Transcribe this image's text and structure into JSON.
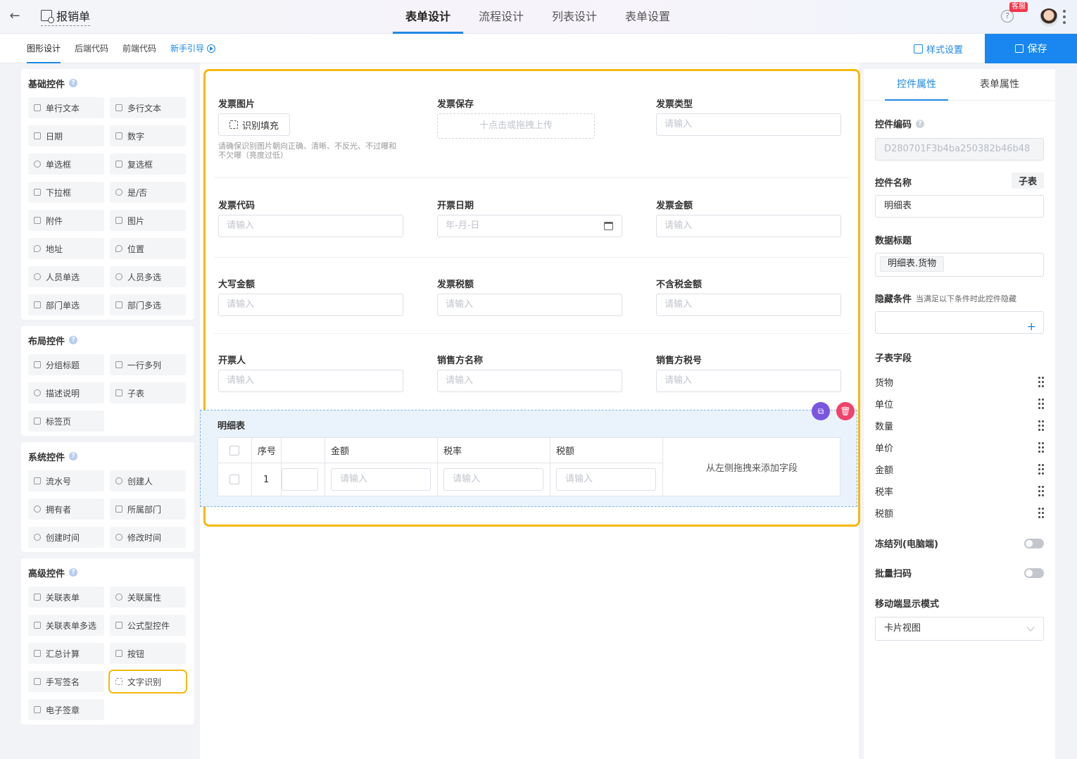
{
  "topbar": {
    "title": "报销单",
    "tabs": [
      "表单设计",
      "流程设计",
      "列表设计",
      "表单设置"
    ],
    "active_tab": "表单设计",
    "kefu_badge": "客服",
    "help": "?"
  },
  "subbar": {
    "tabs": [
      "图形设计",
      "后端代码",
      "前端代码"
    ],
    "guide": "新手引导",
    "style_button": "样式设置",
    "save_button": "保存"
  },
  "left": {
    "groups": [
      {
        "title": "基础控件",
        "items": [
          "单行文本",
          "多行文本",
          "日期",
          "数字",
          "单选框",
          "复选框",
          "下拉框",
          "是/否",
          "附件",
          "图片",
          "地址",
          "位置",
          "人员单选",
          "人员多选",
          "部门单选",
          "部门多选"
        ]
      },
      {
        "title": "布局控件",
        "items": [
          "分组标题",
          "一行多列",
          "描述说明",
          "子表",
          "标签页"
        ]
      },
      {
        "title": "系统控件",
        "items": [
          "流水号",
          "创建人",
          "拥有者",
          "所属部门",
          "创建时间",
          "修改时间"
        ]
      },
      {
        "title": "高级控件",
        "items": [
          "关联表单",
          "关联属性",
          "关联表单多选",
          "公式型控件",
          "汇总计算",
          "按钮",
          "手写签名",
          "文字识别",
          "电子签章"
        ]
      }
    ],
    "highlighted_item": "文字识别"
  },
  "form": {
    "invoice_image": {
      "label": "发票图片",
      "button": "识别填充",
      "hint": "请确保识别图片朝向正确、清晰、不反光、不过曝和不欠曝（亮度过低）"
    },
    "invoice_save": {
      "label": "发票保存",
      "upload": "十点击或拖拽上传"
    },
    "invoice_type": {
      "label": "发票类型",
      "placeholder": "请输入"
    },
    "invoice_code": {
      "label": "发票代码",
      "placeholder": "请输入"
    },
    "issue_date": {
      "label": "开票日期",
      "placeholder": "年-月-日"
    },
    "invoice_amount": {
      "label": "发票金额",
      "placeholder": "请输入"
    },
    "amount_upper": {
      "label": "大写金额",
      "placeholder": "请输入"
    },
    "invoice_tax": {
      "label": "发票税额",
      "placeholder": "请输入"
    },
    "amount_ex_tax": {
      "label": "不含税金额",
      "placeholder": "请输入"
    },
    "drawer": {
      "label": "开票人",
      "placeholder": "请输入"
    },
    "seller_name": {
      "label": "销售方名称",
      "placeholder": "请输入"
    },
    "seller_tax_no": {
      "label": "销售方税号",
      "placeholder": "请输入"
    },
    "detail": {
      "title": "明细表",
      "columns": [
        "序号",
        "",
        "金额",
        "税率",
        "税额"
      ],
      "row_index": "1",
      "placeholder": "请输入",
      "drop_hint": "从左侧拖拽来添加字段"
    }
  },
  "right": {
    "tabs": [
      "控件属性",
      "表单属性"
    ],
    "control_code_label": "控件编码",
    "control_code_value": "D280701F3b4ba250382b46b48",
    "control_name_label": "控件名称",
    "control_type_tag": "子表",
    "control_name_value": "明细表",
    "data_title_label": "数据标题",
    "data_title_chip": "明细表.货物",
    "hide_cond_label": "隐藏条件",
    "hide_cond_hint": "当满足以下条件时此控件隐藏",
    "plus": "+",
    "sub_fields_label": "子表字段",
    "sub_fields": [
      "货物",
      "单位",
      "数量",
      "单价",
      "金额",
      "税率",
      "税额"
    ],
    "freeze_label": "冻结列(电脑端)",
    "freeze_on": false,
    "batch_scan_label": "批量扫码",
    "batch_scan_on": false,
    "mobile_mode_label": "移动端显示模式",
    "mobile_mode_value": "卡片视图"
  }
}
